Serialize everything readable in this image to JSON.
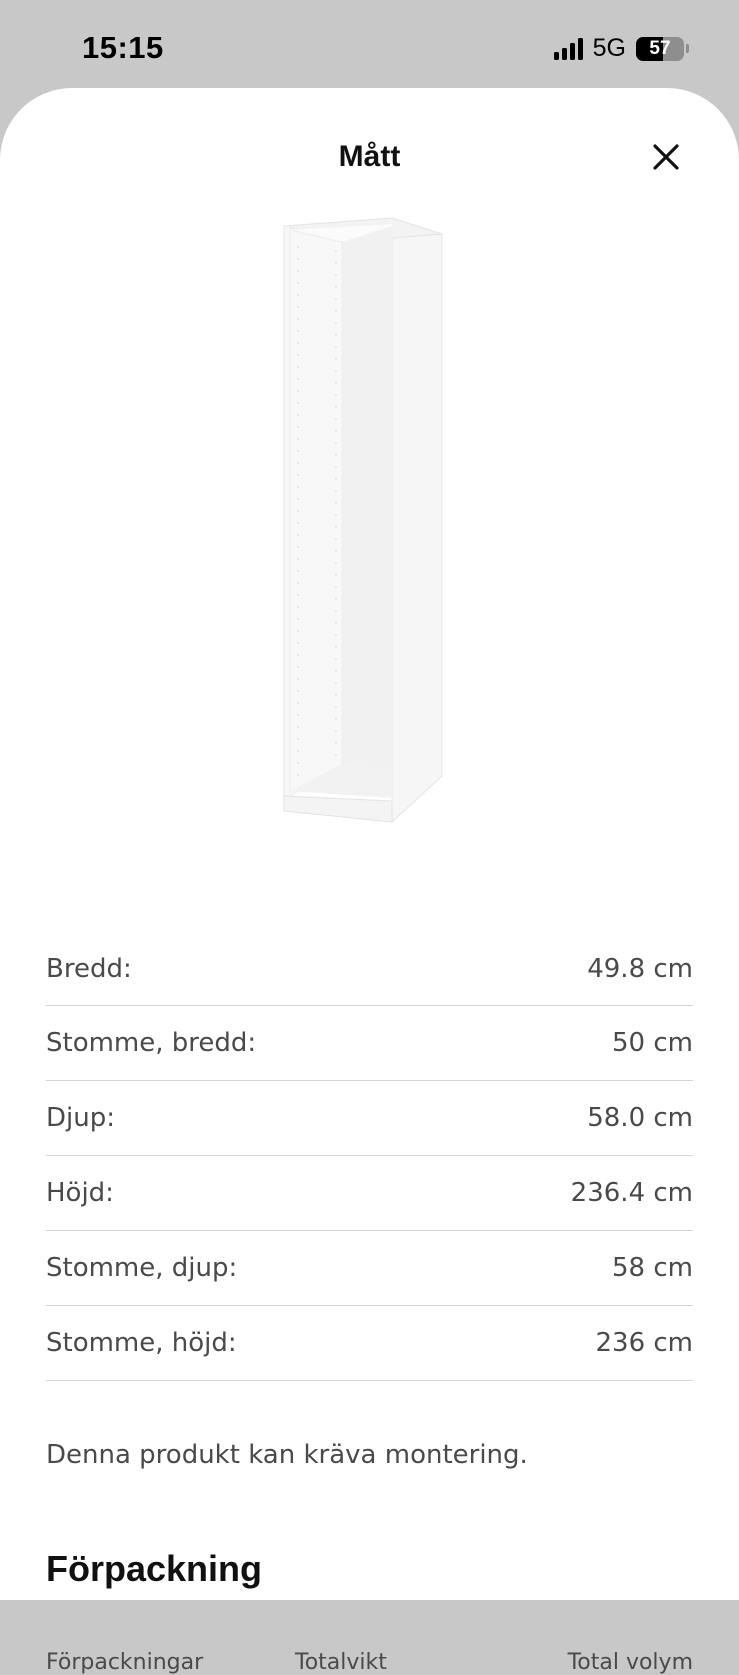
{
  "status_bar": {
    "time": "15:15",
    "network": "5G",
    "battery": "57",
    "battery_level": 0.57
  },
  "sheet": {
    "title": "Mått",
    "close_icon": "close-icon"
  },
  "dimensions": [
    {
      "label": "Bredd:",
      "value": "49.8 cm"
    },
    {
      "label": "Stomme, bredd:",
      "value": "50 cm"
    },
    {
      "label": "Djup:",
      "value": "58.0 cm"
    },
    {
      "label": "Höjd:",
      "value": "236.4 cm"
    },
    {
      "label": "Stomme, djup:",
      "value": "58 cm"
    },
    {
      "label": "Stomme, höjd:",
      "value": "236 cm"
    }
  ],
  "assembly_note": "Denna produkt kan kräva montering.",
  "packaging": {
    "heading": "Förpackning",
    "columns": [
      "Förpackningar",
      "Totalvikt",
      "Total volym"
    ]
  }
}
